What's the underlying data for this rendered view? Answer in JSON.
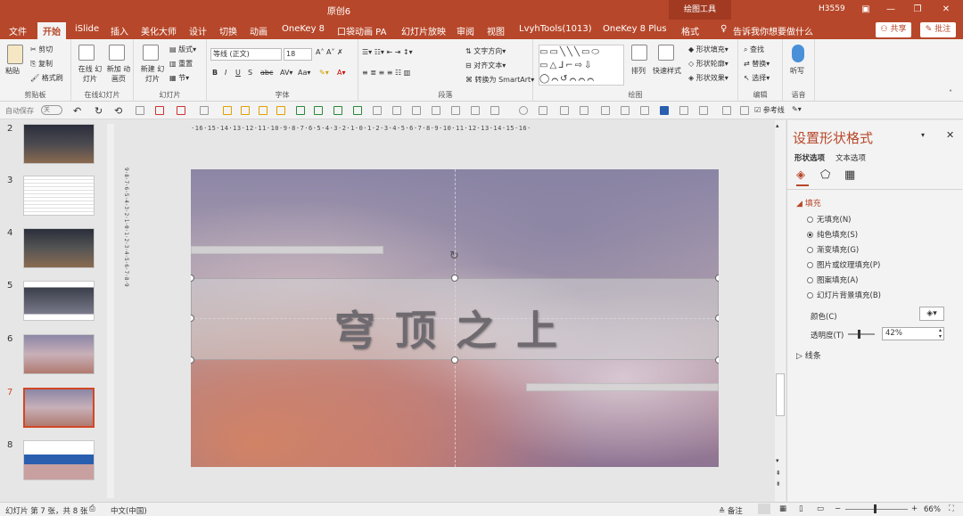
{
  "titlebar": {
    "doc_title": "原创6",
    "context_tab": "绘图工具",
    "user": "H3559",
    "minimize": "—",
    "restore": "❐",
    "maximize": "▢",
    "close": "✕"
  },
  "tabs": [
    "文件",
    "开始",
    "iSlide",
    "插入",
    "美化大师",
    "设计",
    "切换",
    "动画",
    "OneKey 8",
    "口袋动画 PA",
    "幻灯片放映",
    "审阅",
    "视图",
    "LvyhTools(1013)",
    "OneKey 8 Plus",
    "格式"
  ],
  "active_tab": "开始",
  "tell_me": "告诉我你想要做什么",
  "share_label": "共享",
  "comment_label": "批注",
  "ribbon": {
    "clipboard": {
      "paste": "粘贴",
      "cut": "剪切",
      "copy": "复制",
      "format_painter": "格式刷",
      "group": "剪贴板"
    },
    "online": {
      "online_slides": "在线 幻灯片",
      "new_anim": "新加 动画页",
      "group": "在线幻灯片"
    },
    "slides": {
      "new_slide": "新建 幻灯片",
      "layout": "版式",
      "reset": "重置",
      "section": "节",
      "group": "幻灯片"
    },
    "font": {
      "font_name": "等线 (正文)",
      "font_size": "18",
      "group": "字体"
    },
    "paragraph": {
      "text_direction": "文字方向",
      "align_text": "对齐文本",
      "smartart": "转换为 SmartArt",
      "group": "段落"
    },
    "drawing": {
      "arrange": "排列",
      "quick_styles": "快速样式",
      "shape_fill": "形状填充",
      "shape_outline": "形状轮廓",
      "shape_effects": "形状效果",
      "group": "绘图"
    },
    "editing": {
      "find": "查找",
      "replace": "替换",
      "select": "选择",
      "group": "编辑"
    },
    "voice": {
      "dictate": "听写",
      "group": "语音"
    }
  },
  "qat": {
    "autosave": "自动保存",
    "autosave_state": "关",
    "guides": "参考线"
  },
  "slides_panel": [
    {
      "num": "2"
    },
    {
      "num": "3"
    },
    {
      "num": "4"
    },
    {
      "num": "5"
    },
    {
      "num": "6"
    },
    {
      "num": "7"
    },
    {
      "num": "8"
    }
  ],
  "ruler_h": "·16·15·14·13·12·11·10·9·8·7·6·5·4·3·2·1·0·1·2·3·4·5·6·7·8·9·10·11·12·13·14·15·16·",
  "ruler_v": "9·8·7·6·5·4·3·2·1·0·1·2·3·4·5·6·7·8·9",
  "slide": {
    "title": "穹顶之上"
  },
  "pane": {
    "title": "设置形状格式",
    "tab_shape": "形状选项",
    "tab_text": "文本选项",
    "fill_section": "填充",
    "options": [
      "无填充(N)",
      "纯色填充(S)",
      "渐变填充(G)",
      "图片或纹理填充(P)",
      "图案填充(A)",
      "幻灯片背景填充(B)"
    ],
    "selected_option": "纯色填充(S)",
    "color_label": "颜色(C)",
    "transparency_label": "透明度(T)",
    "transparency_value": "42%",
    "transparency": 0.42,
    "line_section": "线条"
  },
  "status": {
    "slide_info": "幻灯片 第 7 张，共 8 张",
    "language": "中文(中国)",
    "notes": "备注",
    "zoom": "66%"
  },
  "colors": {
    "accent": "#b7472a",
    "thumb_selected": "#d24726"
  }
}
